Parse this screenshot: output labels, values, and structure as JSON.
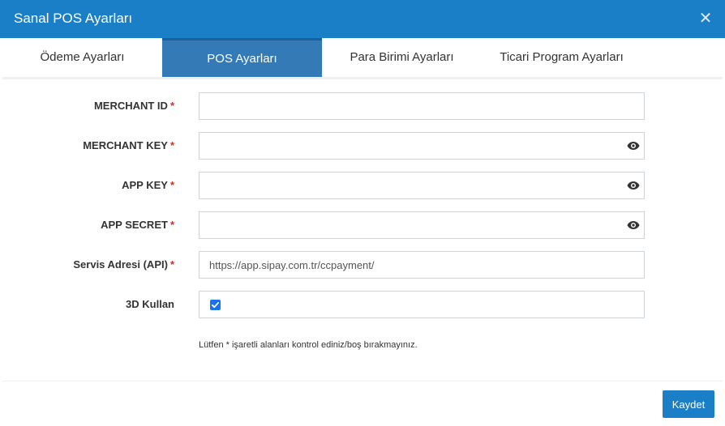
{
  "modal": {
    "title": "Sanal POS Ayarları",
    "close_symbol": "✕"
  },
  "tabs": [
    {
      "label": "Ödeme Ayarları",
      "active": false
    },
    {
      "label": "POS Ayarları",
      "active": true
    },
    {
      "label": "Para Birimi Ayarları",
      "active": false
    },
    {
      "label": "Ticari Program Ayarları",
      "active": false
    }
  ],
  "form": {
    "merchant_id": {
      "label": "MERCHANT ID",
      "required_mark": "*",
      "value": ""
    },
    "merchant_key": {
      "label": "MERCHANT KEY",
      "required_mark": "*",
      "value": "",
      "icon": "eye-icon"
    },
    "app_key": {
      "label": "APP KEY",
      "required_mark": "*",
      "value": "",
      "icon": "eye-icon"
    },
    "app_secret": {
      "label": "APP SECRET",
      "required_mark": "*",
      "value": "",
      "icon": "eye-icon"
    },
    "service_url": {
      "label": "Servis Adresi (API)",
      "required_mark": "*",
      "value": "https://app.sipay.com.tr/ccpayment/"
    },
    "use_3d": {
      "label": "3D Kullan",
      "checked": true
    }
  },
  "hint": "Lütfen * işaretli alanları kontrol ediniz/boş bırakmayınız.",
  "footer": {
    "save_label": "Kaydet"
  },
  "colors": {
    "header": "#1a7fc7",
    "active_tab": "#337ab7",
    "required": "#c9302c",
    "button": "#1a7fc7"
  }
}
